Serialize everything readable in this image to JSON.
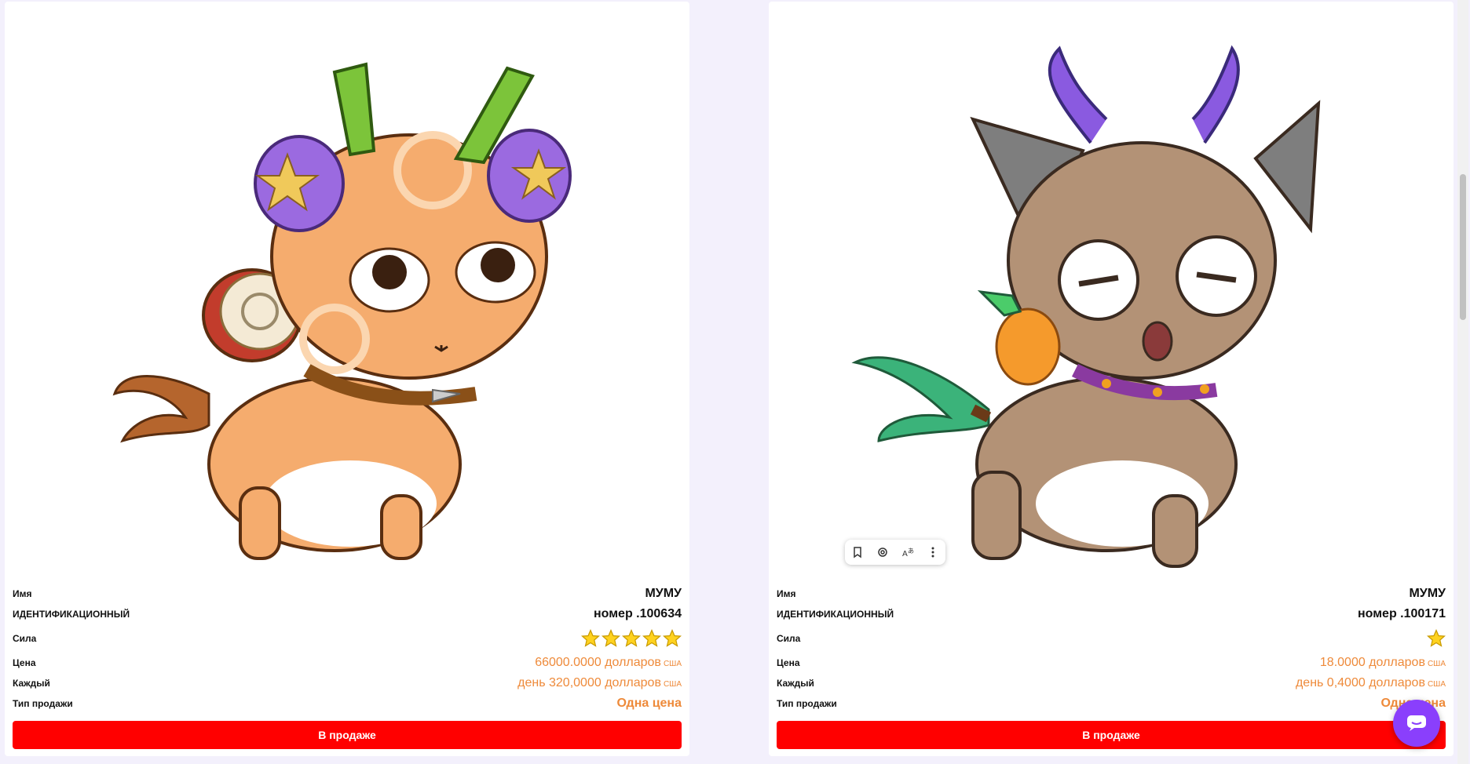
{
  "labels": {
    "name": "Имя",
    "id": "ИДЕНТИФИКАЦИОННЫЙ",
    "power": "Сила",
    "price": "Цена",
    "each": "Каждый",
    "sale_type": "Тип продажи"
  },
  "cards": [
    {
      "name": "МУМУ",
      "id": "номер .100634",
      "stars": 5,
      "price": "66000.0000 долларов",
      "price_unit": "США",
      "daily": "день 320,0000 долларов",
      "daily_unit": "США",
      "sale_type": "Одна цена",
      "button": "В продаже"
    },
    {
      "name": "МУМУ",
      "id": "номер .100171",
      "stars": 1,
      "price": "18.0000 долларов",
      "price_unit": "США",
      "daily": "день 0,4000 долларов",
      "daily_unit": "США",
      "sale_type": "Одна цена",
      "button": "В продаже"
    }
  ],
  "colors": {
    "accent": "#ee8a3a",
    "button": "#ff0000",
    "chat": "#8a3ffc"
  },
  "toolbar_icons": [
    "bookmark-icon",
    "lens-icon",
    "translate-icon",
    "more-icon"
  ]
}
